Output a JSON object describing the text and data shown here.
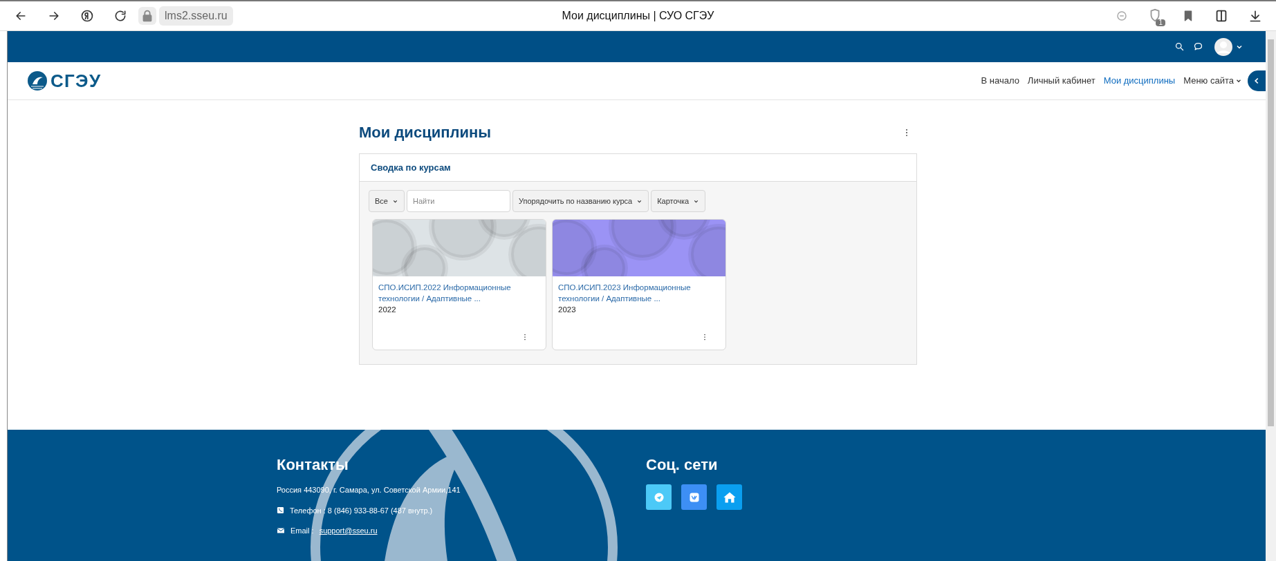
{
  "browser": {
    "url": "lms2.sseu.ru",
    "title": "Мои дисциплины | СУО СГЭУ",
    "badge": "1"
  },
  "brand": {
    "name": "СГЭУ"
  },
  "nav": [
    {
      "label": "В начало",
      "selected": false,
      "kind": "link"
    },
    {
      "label": "Личный кабинет",
      "selected": false,
      "kind": "link"
    },
    {
      "label": "Мои дисциплины",
      "selected": true,
      "kind": "link"
    },
    {
      "label": "Меню сайта",
      "selected": false,
      "kind": "dropdown"
    }
  ],
  "page": {
    "title": "Мои дисциплины"
  },
  "block": {
    "title": "Сводка по курсам",
    "filters": [
      {
        "kind": "select",
        "label": "Все"
      },
      {
        "kind": "search",
        "placeholder": "Найти"
      },
      {
        "kind": "select",
        "label": "Упорядочить по названию курса"
      },
      {
        "kind": "select",
        "label": "Карточка"
      }
    ],
    "courses": [
      {
        "name": "СПО.ИСИП.2022 Информационные технологии / Адаптивные ...",
        "category": "2022",
        "color": "#dde3e6"
      },
      {
        "name": "СПО.ИСИП.2023 Информационные технологии / Адаптивные ...",
        "category": "2023",
        "color": "#9b93f5"
      }
    ]
  },
  "footer": {
    "contacts_title": "Контакты",
    "address": "Россия 443090, г. Самара, ул. Советской Армии,141",
    "phone": "Телефон : 8 (846) 933-88-67 (487 внутр.)",
    "email_label": "Email :",
    "email": "support@sseu.ru",
    "social_title": "Соц. сети",
    "social": [
      {
        "kind": "telegram",
        "color": "#4cc9f7"
      },
      {
        "kind": "vk",
        "color": "#3d8ff5"
      },
      {
        "kind": "home",
        "color": "#0a9ff0"
      }
    ]
  }
}
